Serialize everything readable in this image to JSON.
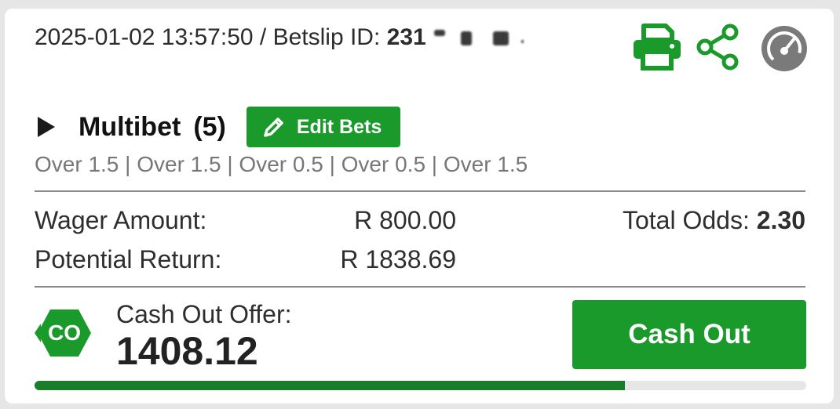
{
  "header": {
    "datetime": "2025-01-02 13:57:50",
    "separator": " / ",
    "betslip_label": "Betslip ID: ",
    "betslip_id_visible": "231"
  },
  "icons": {
    "print": "print-icon",
    "share": "share-icon",
    "gauge": "speedometer-icon"
  },
  "bet": {
    "title": "Multibet",
    "count": "(5)",
    "edit_label": "Edit Bets",
    "selections": "Over 1.5 | Over 1.5 | Over 0.5 | Over 0.5 | Over 1.5"
  },
  "summary": {
    "wager_label": "Wager Amount:",
    "wager_value": "R 800.00",
    "return_label": "Potential Return:",
    "return_value": "R 1838.69",
    "odds_label": "Total Odds: ",
    "odds_value": "2.30"
  },
  "cashout": {
    "logo_text": "CO",
    "offer_label": "Cash Out Offer:",
    "offer_value": "1408.12",
    "button_label": "Cash Out",
    "progress_fraction": 0.765
  },
  "colors": {
    "brand_green": "#1a9a2a",
    "progress_green": "#1a7d2a",
    "gauge_grey": "#7a7a7a"
  }
}
